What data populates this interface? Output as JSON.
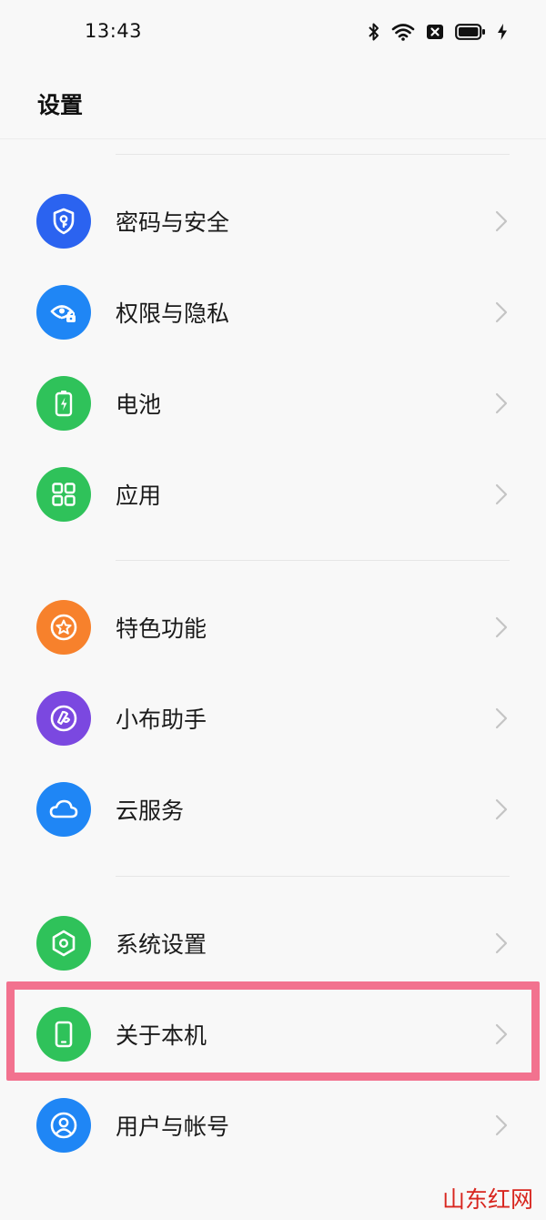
{
  "status_bar": {
    "time": "13:43",
    "icons": [
      "bluetooth-icon",
      "wifi-icon",
      "no-sim-icon",
      "battery-icon",
      "charging-icon"
    ]
  },
  "page": {
    "title": "设置"
  },
  "settings_items": [
    {
      "label": "密码与安全",
      "icon": "shield-key-icon",
      "color": "#2b63f0"
    },
    {
      "label": "权限与隐私",
      "icon": "eye-lock-icon",
      "color": "#1f86f5"
    },
    {
      "label": "电池",
      "icon": "battery-charging-icon",
      "color": "#2fc25a"
    },
    {
      "label": "应用",
      "icon": "apps-grid-icon",
      "color": "#2fc25a"
    },
    {
      "label": "特色功能",
      "icon": "star-circle-icon",
      "color": "#f7812c"
    },
    {
      "label": "小布助手",
      "icon": "assistant-icon",
      "color": "#7b48e0"
    },
    {
      "label": "云服务",
      "icon": "cloud-icon",
      "color": "#1f86f5"
    },
    {
      "label": "系统设置",
      "icon": "hexagon-settings-icon",
      "color": "#2fc25a"
    },
    {
      "label": "关于本机",
      "icon": "phone-icon",
      "color": "#2fc25a"
    },
    {
      "label": "用户与帐号",
      "icon": "user-icon",
      "color": "#1f86f5"
    }
  ],
  "highlighted_item": "关于本机",
  "highlight_color": "#f2728f",
  "watermark": "山东红网"
}
